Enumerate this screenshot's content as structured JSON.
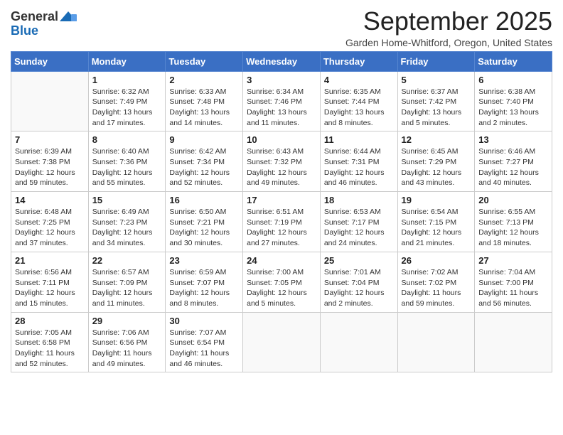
{
  "logo": {
    "general": "General",
    "blue": "Blue"
  },
  "title": "September 2025",
  "subtitle": "Garden Home-Whitford, Oregon, United States",
  "days_header": [
    "Sunday",
    "Monday",
    "Tuesday",
    "Wednesday",
    "Thursday",
    "Friday",
    "Saturday"
  ],
  "weeks": [
    [
      {
        "num": "",
        "info": ""
      },
      {
        "num": "1",
        "info": "Sunrise: 6:32 AM\nSunset: 7:49 PM\nDaylight: 13 hours\nand 17 minutes."
      },
      {
        "num": "2",
        "info": "Sunrise: 6:33 AM\nSunset: 7:48 PM\nDaylight: 13 hours\nand 14 minutes."
      },
      {
        "num": "3",
        "info": "Sunrise: 6:34 AM\nSunset: 7:46 PM\nDaylight: 13 hours\nand 11 minutes."
      },
      {
        "num": "4",
        "info": "Sunrise: 6:35 AM\nSunset: 7:44 PM\nDaylight: 13 hours\nand 8 minutes."
      },
      {
        "num": "5",
        "info": "Sunrise: 6:37 AM\nSunset: 7:42 PM\nDaylight: 13 hours\nand 5 minutes."
      },
      {
        "num": "6",
        "info": "Sunrise: 6:38 AM\nSunset: 7:40 PM\nDaylight: 13 hours\nand 2 minutes."
      }
    ],
    [
      {
        "num": "7",
        "info": "Sunrise: 6:39 AM\nSunset: 7:38 PM\nDaylight: 12 hours\nand 59 minutes."
      },
      {
        "num": "8",
        "info": "Sunrise: 6:40 AM\nSunset: 7:36 PM\nDaylight: 12 hours\nand 55 minutes."
      },
      {
        "num": "9",
        "info": "Sunrise: 6:42 AM\nSunset: 7:34 PM\nDaylight: 12 hours\nand 52 minutes."
      },
      {
        "num": "10",
        "info": "Sunrise: 6:43 AM\nSunset: 7:32 PM\nDaylight: 12 hours\nand 49 minutes."
      },
      {
        "num": "11",
        "info": "Sunrise: 6:44 AM\nSunset: 7:31 PM\nDaylight: 12 hours\nand 46 minutes."
      },
      {
        "num": "12",
        "info": "Sunrise: 6:45 AM\nSunset: 7:29 PM\nDaylight: 12 hours\nand 43 minutes."
      },
      {
        "num": "13",
        "info": "Sunrise: 6:46 AM\nSunset: 7:27 PM\nDaylight: 12 hours\nand 40 minutes."
      }
    ],
    [
      {
        "num": "14",
        "info": "Sunrise: 6:48 AM\nSunset: 7:25 PM\nDaylight: 12 hours\nand 37 minutes."
      },
      {
        "num": "15",
        "info": "Sunrise: 6:49 AM\nSunset: 7:23 PM\nDaylight: 12 hours\nand 34 minutes."
      },
      {
        "num": "16",
        "info": "Sunrise: 6:50 AM\nSunset: 7:21 PM\nDaylight: 12 hours\nand 30 minutes."
      },
      {
        "num": "17",
        "info": "Sunrise: 6:51 AM\nSunset: 7:19 PM\nDaylight: 12 hours\nand 27 minutes."
      },
      {
        "num": "18",
        "info": "Sunrise: 6:53 AM\nSunset: 7:17 PM\nDaylight: 12 hours\nand 24 minutes."
      },
      {
        "num": "19",
        "info": "Sunrise: 6:54 AM\nSunset: 7:15 PM\nDaylight: 12 hours\nand 21 minutes."
      },
      {
        "num": "20",
        "info": "Sunrise: 6:55 AM\nSunset: 7:13 PM\nDaylight: 12 hours\nand 18 minutes."
      }
    ],
    [
      {
        "num": "21",
        "info": "Sunrise: 6:56 AM\nSunset: 7:11 PM\nDaylight: 12 hours\nand 15 minutes."
      },
      {
        "num": "22",
        "info": "Sunrise: 6:57 AM\nSunset: 7:09 PM\nDaylight: 12 hours\nand 11 minutes."
      },
      {
        "num": "23",
        "info": "Sunrise: 6:59 AM\nSunset: 7:07 PM\nDaylight: 12 hours\nand 8 minutes."
      },
      {
        "num": "24",
        "info": "Sunrise: 7:00 AM\nSunset: 7:05 PM\nDaylight: 12 hours\nand 5 minutes."
      },
      {
        "num": "25",
        "info": "Sunrise: 7:01 AM\nSunset: 7:04 PM\nDaylight: 12 hours\nand 2 minutes."
      },
      {
        "num": "26",
        "info": "Sunrise: 7:02 AM\nSunset: 7:02 PM\nDaylight: 11 hours\nand 59 minutes."
      },
      {
        "num": "27",
        "info": "Sunrise: 7:04 AM\nSunset: 7:00 PM\nDaylight: 11 hours\nand 56 minutes."
      }
    ],
    [
      {
        "num": "28",
        "info": "Sunrise: 7:05 AM\nSunset: 6:58 PM\nDaylight: 11 hours\nand 52 minutes."
      },
      {
        "num": "29",
        "info": "Sunrise: 7:06 AM\nSunset: 6:56 PM\nDaylight: 11 hours\nand 49 minutes."
      },
      {
        "num": "30",
        "info": "Sunrise: 7:07 AM\nSunset: 6:54 PM\nDaylight: 11 hours\nand 46 minutes."
      },
      {
        "num": "",
        "info": ""
      },
      {
        "num": "",
        "info": ""
      },
      {
        "num": "",
        "info": ""
      },
      {
        "num": "",
        "info": ""
      }
    ]
  ]
}
